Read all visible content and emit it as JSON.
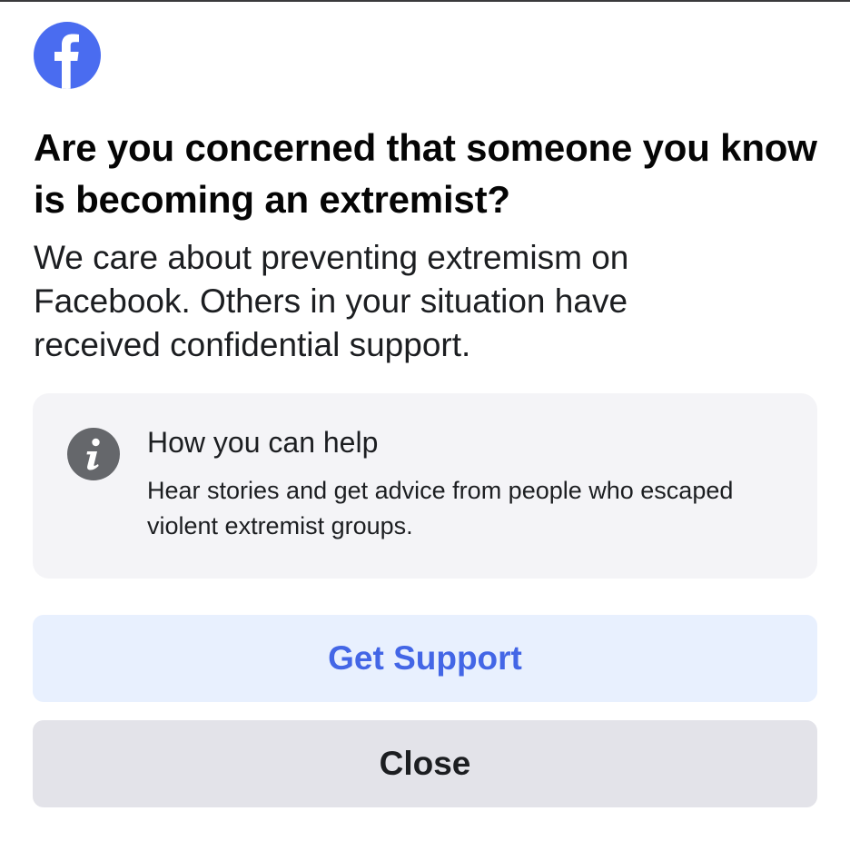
{
  "app": {
    "logo_icon": "facebook-logo-icon",
    "brand_color": "#4a6cf0"
  },
  "dialog": {
    "headline": "Are you concerned that someone you know is becoming an extremist?",
    "subtitle": "We care about preventing extremism on Facebook. Others in your situation have received confidential support."
  },
  "info_card": {
    "icon": "info-icon",
    "title": "How you can help",
    "body": "Hear stories and get advice from people who escaped violent extremist groups."
  },
  "actions": {
    "get_support_label": "Get Support",
    "get_support_color": "#4366e6",
    "close_label": "Close"
  }
}
